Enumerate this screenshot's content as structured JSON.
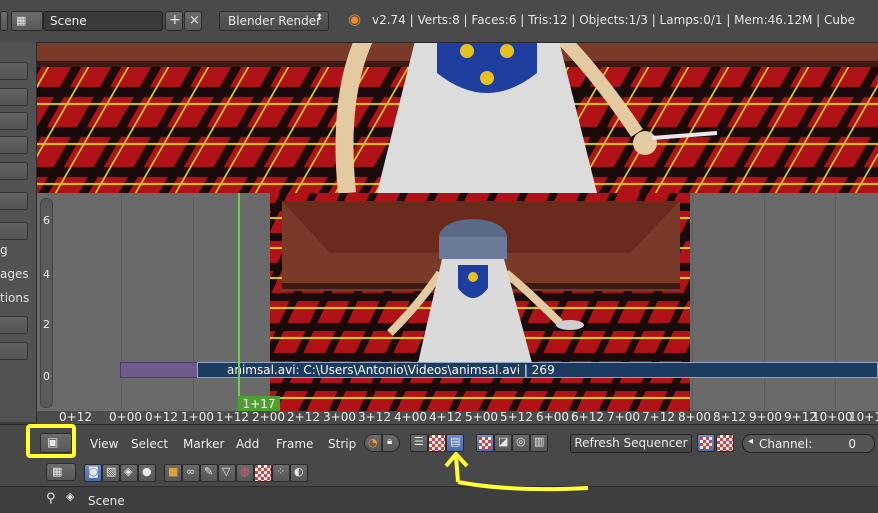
{
  "topbar": {
    "scene_name": "Scene",
    "render_engine": "Blender Render",
    "stats": "v2.74 | Verts:8 | Faces:6 | Tris:12 | Objects:1/3 | Lamps:0/1 | Mem:46.12M | Cube",
    "add_icon": "plus-icon",
    "close_icon": "x-icon"
  },
  "toolshelf": {
    "labels": [
      "g",
      "ages",
      "tions"
    ]
  },
  "sequencer": {
    "y_labels": [
      "6",
      "4",
      "2",
      "0"
    ],
    "current_frame": "1+17",
    "strip_label": "animsal.avi: C:\\Users\\Antonio\\Videos\\animsal.avi | 269",
    "ruler_ticks": [
      "0+12",
      "0+00",
      "0+12",
      "1+00",
      "1+12",
      "2+00",
      "2+12",
      "3+00",
      "3+12",
      "4+00",
      "4+12",
      "5+00",
      "5+12",
      "6+00",
      "6+12",
      "7+00",
      "7+12",
      "8+00",
      "8+12",
      "9+00",
      "9+12",
      "10+00",
      "10+1"
    ]
  },
  "header": {
    "menus": [
      "View",
      "Select",
      "Marker",
      "Add",
      "Frame",
      "Strip"
    ],
    "refresh_label": "Refresh Sequencer",
    "channel_label": "Channel:",
    "channel_value": "0"
  },
  "footer": {
    "scene_label": "Scene"
  },
  "colors": {
    "accent": "#ffff33",
    "playhead": "#6ad24a",
    "strip": "#1c3b60"
  }
}
